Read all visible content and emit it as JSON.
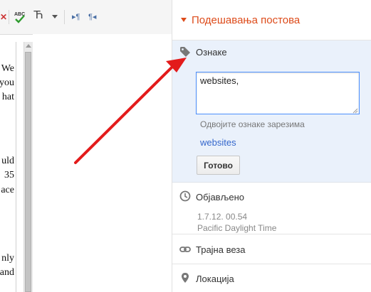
{
  "toolbar": {
    "spellcheck_label": "ABC",
    "spellcheck_icon": "spellcheck-icon",
    "cyrillic_label": "Ћ",
    "dropdown_icon": "chevron-down-icon",
    "ltr_label": "▸¶",
    "rtl_label": "¶◂"
  },
  "editor": {
    "visible_fragments": [
      "We",
      "you",
      "hat",
      "uld",
      "35",
      "ace",
      "nly",
      "and"
    ]
  },
  "panel": {
    "title": "Подешавања постова",
    "accent_color": "#dd4b1a",
    "labels": {
      "heading": "Ознаке",
      "icon": "tag-icon",
      "input_value": "websites,",
      "hint": "Одвојите ознаке зарезима",
      "suggestion": "websites",
      "done_button": "Готово"
    },
    "published": {
      "heading": "Објављено",
      "icon": "clock-icon",
      "date": "1.7.12. 00.54",
      "timezone": "Pacific Daylight Time"
    },
    "permalink": {
      "heading": "Трајна веза",
      "icon": "link-icon"
    },
    "location": {
      "heading": "Локација",
      "icon": "location-pin-icon"
    }
  }
}
